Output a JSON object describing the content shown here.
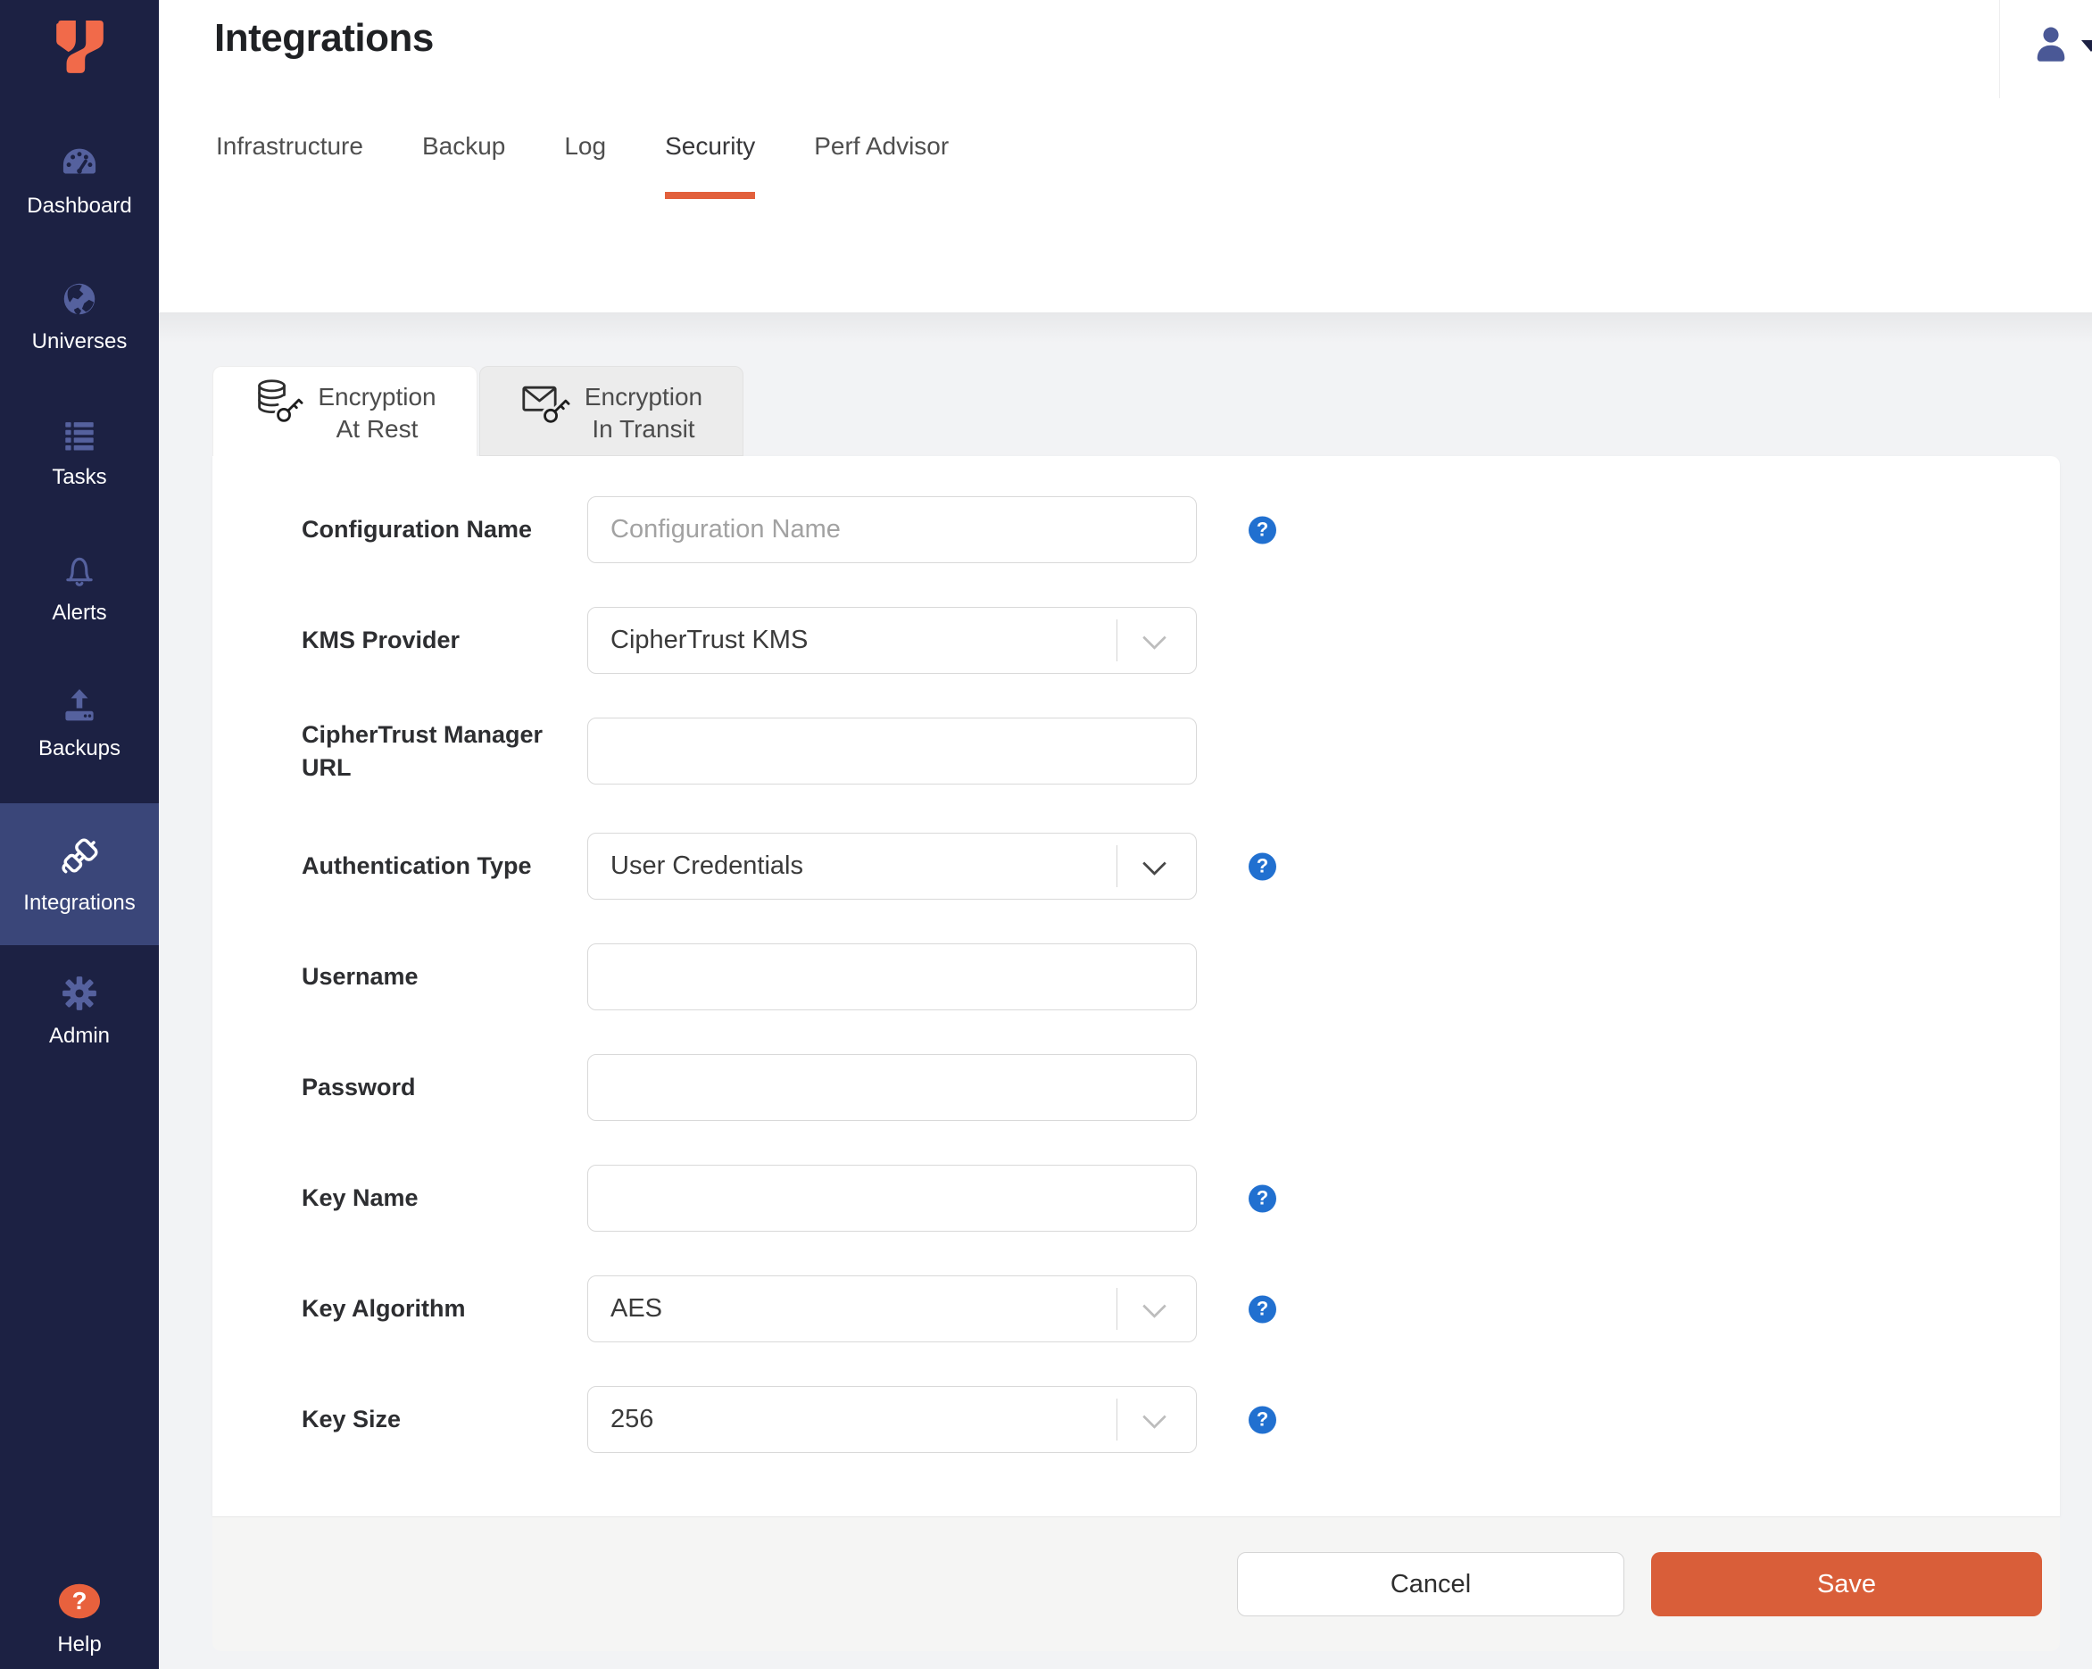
{
  "colors": {
    "sidebar_bg": "#1c2143",
    "sidebar_active_bg": "#3a4679",
    "sidebar_icon": "#55619e",
    "accent_orange": "#e2603c",
    "save_orange": "#d95e39",
    "logo_orange": "#f16a4a",
    "help_blue": "#2170d0",
    "page_bg": "#f2f3f5"
  },
  "icons": {
    "question_glyph": "?"
  },
  "sidebar": {
    "items": [
      {
        "label": "Dashboard",
        "icon": "dashboard-icon"
      },
      {
        "label": "Universes",
        "icon": "universes-icon"
      },
      {
        "label": "Tasks",
        "icon": "tasks-icon"
      },
      {
        "label": "Alerts",
        "icon": "alerts-icon"
      },
      {
        "label": "Backups",
        "icon": "backups-icon"
      },
      {
        "label": "Integrations",
        "icon": "integrations-icon",
        "active": true
      },
      {
        "label": "Admin",
        "icon": "admin-icon"
      }
    ],
    "help": {
      "label": "Help",
      "icon": "help-icon"
    }
  },
  "header": {
    "title": "Integrations",
    "tabs": [
      {
        "label": "Infrastructure",
        "active": false
      },
      {
        "label": "Backup",
        "active": false
      },
      {
        "label": "Log",
        "active": false
      },
      {
        "label": "Security",
        "active": true
      },
      {
        "label": "Perf Advisor",
        "active": false
      }
    ]
  },
  "panel": {
    "tabs": [
      {
        "line1": "Encryption",
        "line2": "At Rest",
        "icon": "database-key-icon",
        "active": true
      },
      {
        "line1": "Encryption",
        "line2": "In Transit",
        "icon": "mail-key-icon",
        "active": false
      }
    ]
  },
  "form": {
    "rows": [
      {
        "label": "Configuration Name",
        "type": "input",
        "value": "",
        "placeholder": "Configuration Name",
        "help": true
      },
      {
        "label": "KMS Provider",
        "type": "select",
        "value": "CipherTrust KMS",
        "help": false,
        "chevron": "muted"
      },
      {
        "label": "CipherTrust Manager URL",
        "type": "input",
        "value": "",
        "placeholder": "",
        "help": false
      },
      {
        "label": "Authentication Type",
        "type": "select",
        "value": "User Credentials",
        "help": true,
        "chevron": "dark"
      },
      {
        "label": "Username",
        "type": "input",
        "value": "",
        "placeholder": "",
        "help": false
      },
      {
        "label": "Password",
        "type": "input",
        "value": "",
        "placeholder": "",
        "help": false
      },
      {
        "label": "Key Name",
        "type": "input",
        "value": "",
        "placeholder": "",
        "help": true
      },
      {
        "label": "Key Algorithm",
        "type": "select",
        "value": "AES",
        "help": true,
        "chevron": "muted"
      },
      {
        "label": "Key Size",
        "type": "select",
        "value": "256",
        "help": true,
        "chevron": "muted"
      }
    ]
  },
  "footer": {
    "cancel_label": "Cancel",
    "save_label": "Save"
  }
}
